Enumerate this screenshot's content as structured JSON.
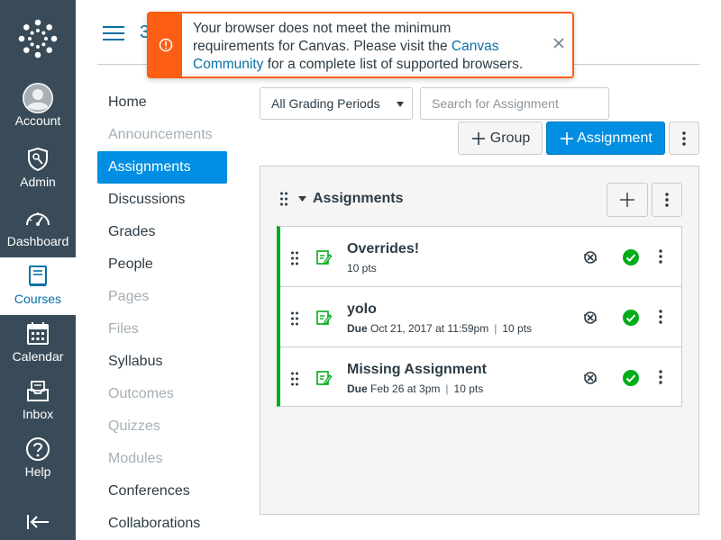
{
  "global_nav": {
    "items": [
      {
        "label": "Account",
        "icon": "account-avatar-icon"
      },
      {
        "label": "Admin",
        "icon": "admin-shield-icon"
      },
      {
        "label": "Dashboard",
        "icon": "dashboard-gauge-icon"
      },
      {
        "label": "Courses",
        "icon": "courses-book-icon",
        "active": true
      },
      {
        "label": "Calendar",
        "icon": "calendar-icon"
      },
      {
        "label": "Inbox",
        "icon": "inbox-icon"
      },
      {
        "label": "Help",
        "icon": "help-icon"
      }
    ],
    "colors": {
      "bg": "#394b58",
      "active_text": "#0770a3"
    }
  },
  "header": {
    "crumb_stub": "3"
  },
  "alert": {
    "text_before": "Your browser does not meet the minimum requirements for Canvas. Please visit the ",
    "link": "Canvas Community",
    "text_after": " for a complete list of supported browsers.",
    "color": "#fc5e13"
  },
  "course_nav": [
    {
      "label": "Home",
      "state": "enabled"
    },
    {
      "label": "Announcements",
      "state": "disabled"
    },
    {
      "label": "Assignments",
      "state": "active"
    },
    {
      "label": "Discussions",
      "state": "enabled"
    },
    {
      "label": "Grades",
      "state": "enabled"
    },
    {
      "label": "People",
      "state": "enabled"
    },
    {
      "label": "Pages",
      "state": "disabled"
    },
    {
      "label": "Files",
      "state": "disabled"
    },
    {
      "label": "Syllabus",
      "state": "enabled"
    },
    {
      "label": "Outcomes",
      "state": "disabled"
    },
    {
      "label": "Quizzes",
      "state": "disabled"
    },
    {
      "label": "Modules",
      "state": "disabled"
    },
    {
      "label": "Conferences",
      "state": "enabled"
    },
    {
      "label": "Collaborations",
      "state": "enabled"
    }
  ],
  "toolbar": {
    "grading_period": "All Grading Periods",
    "search_placeholder": "Search for Assignment",
    "group_button": "Group",
    "assignment_button": "Assignment",
    "accent": "#008ee2"
  },
  "group": {
    "title": "Assignments",
    "border_color": "#00ac18",
    "assignments": [
      {
        "title": "Overrides!",
        "due_label": "",
        "due": "",
        "points": "10 pts"
      },
      {
        "title": "yolo",
        "due_label": "Due",
        "due": "Oct 21, 2017 at 11:59pm",
        "points": "10 pts"
      },
      {
        "title": "Missing Assignment",
        "due_label": "Due",
        "due": "Feb 26 at 3pm",
        "points": "10 pts"
      }
    ]
  }
}
